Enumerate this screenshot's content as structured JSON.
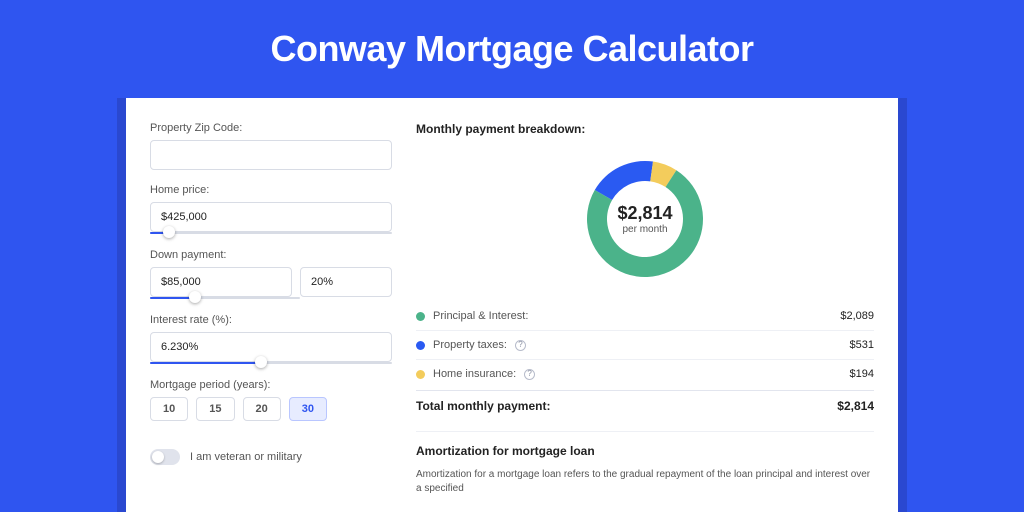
{
  "header": {
    "title": "Conway Mortgage Calculator"
  },
  "form": {
    "zip_label": "Property Zip Code:",
    "zip_value": "",
    "home_price_label": "Home price:",
    "home_price_value": "$425,000",
    "home_price_slider_pct": 8,
    "down_payment_label": "Down payment:",
    "down_payment_value": "$85,000",
    "down_payment_pct_value": "20%",
    "down_payment_slider_pct": 30,
    "interest_label": "Interest rate (%):",
    "interest_value": "6.230%",
    "interest_slider_pct": 46,
    "period_label": "Mortgage period (years):",
    "periods": [
      "10",
      "15",
      "20",
      "30"
    ],
    "period_selected": "30",
    "veteran_label": "I am veteran or military",
    "veteran_on": false
  },
  "breakdown": {
    "title": "Monthly payment breakdown:",
    "center_amount": "$2,814",
    "center_caption": "per month",
    "items": [
      {
        "label": "Principal & Interest:",
        "value": "$2,089",
        "color": "#4bb38a",
        "help": false
      },
      {
        "label": "Property taxes:",
        "value": "$531",
        "color": "#2a5af2",
        "help": true
      },
      {
        "label": "Home insurance:",
        "value": "$194",
        "color": "#f3cc5c",
        "help": true
      }
    ],
    "total_label": "Total monthly payment:",
    "total_value": "$2,814"
  },
  "chart_data": {
    "type": "pie",
    "title": "Monthly payment breakdown",
    "series": [
      {
        "name": "Principal & Interest",
        "value": 2089,
        "color": "#4bb38a"
      },
      {
        "name": "Property taxes",
        "value": 531,
        "color": "#2a5af2"
      },
      {
        "name": "Home insurance",
        "value": 194,
        "color": "#f3cc5c"
      }
    ],
    "center_label": "$2,814 per month",
    "donut": true
  },
  "amortization": {
    "title": "Amortization for mortgage loan",
    "text": "Amortization for a mortgage loan refers to the gradual repayment of the loan principal and interest over a specified"
  }
}
